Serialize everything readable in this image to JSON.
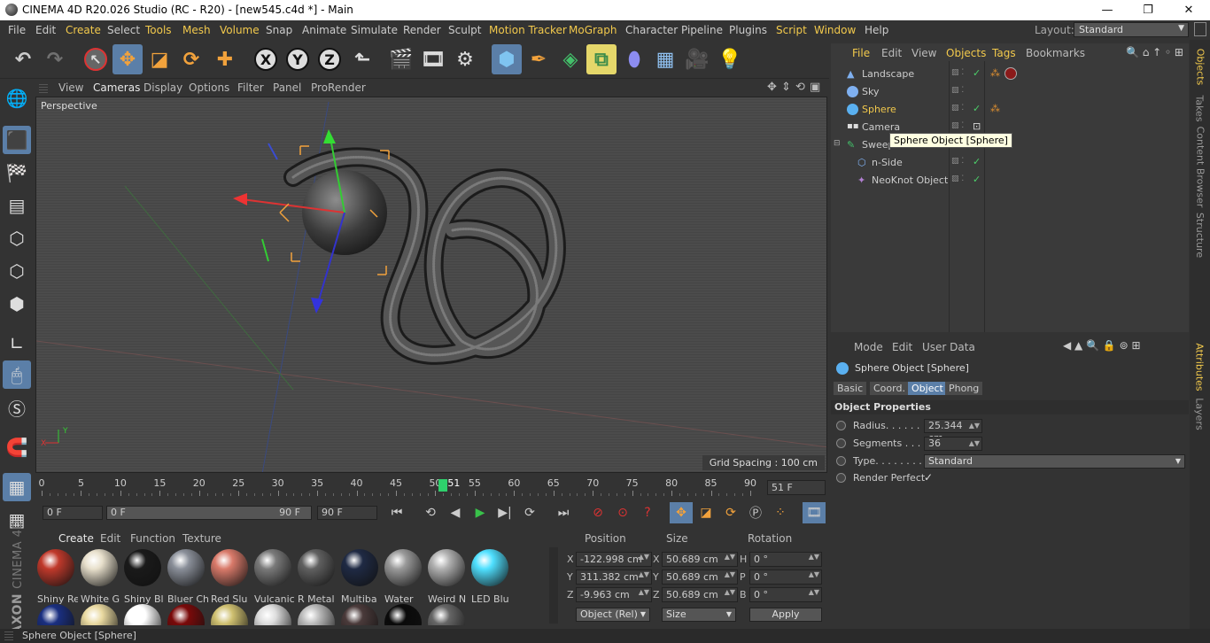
{
  "window": {
    "title": "CINEMA 4D R20.026 Studio (RC - R20) - [new545.c4d *] - Main",
    "controls": [
      "—",
      "❐",
      "✕"
    ]
  },
  "menu": [
    "File",
    "Edit",
    "Create",
    "Select",
    "Tools",
    "Mesh",
    "Volume",
    "Snap",
    "Animate",
    "Simulate",
    "Render",
    "Sculpt",
    "Motion Tracker",
    "MoGraph",
    "Character",
    "Pipeline",
    "Plugins",
    "Script",
    "Window",
    "Help"
  ],
  "highlighted_menus": [
    "Create",
    "Tools",
    "Mesh",
    "Volume",
    "Motion Tracker",
    "MoGraph",
    "Script",
    "Window"
  ],
  "layout": {
    "label": "Layout:",
    "value": "Standard"
  },
  "toolbar": {
    "icons": [
      "undo-icon",
      "redo-icon",
      "live-selection-icon",
      "move-icon",
      "scale-icon",
      "rotate-icon",
      "recent-tool-icon",
      "x-axis-lock-icon",
      "y-axis-lock-icon",
      "z-axis-lock-icon",
      "world-coordinates-icon",
      "render-view-icon",
      "render-picture-viewer-icon",
      "render-settings-icon",
      "cube-icon",
      "pen-spline-icon",
      "subdivision-surface-icon",
      "array-icon",
      "deformer-icon",
      "floor-icon",
      "camera-icon",
      "light-icon"
    ],
    "axis_letters": [
      "X",
      "Y",
      "Z"
    ]
  },
  "viewport": {
    "menu": [
      "View",
      "Cameras",
      "Display",
      "Options",
      "Filter",
      "Panel",
      "ProRender"
    ],
    "active_menu": "Cameras",
    "label": "Perspective",
    "grid_spacing": "Grid Spacing : 100 cm"
  },
  "timeline": {
    "ticks": [
      0,
      5,
      10,
      15,
      20,
      25,
      30,
      35,
      40,
      45,
      50,
      55,
      60,
      65,
      70,
      75,
      80,
      85,
      90
    ],
    "current_frame": 51,
    "current_frame_label": "51",
    "current_frame_field": "51 F"
  },
  "transport": {
    "start_field": "0 F",
    "range_start": "0 F",
    "range_end": "90 F",
    "end_field": "90 F"
  },
  "material_manager": {
    "menu": [
      "Create",
      "Edit",
      "Function",
      "Texture"
    ],
    "active_menu": "Create",
    "materials": [
      {
        "name": "Shiny Re",
        "color": "#c0392b"
      },
      {
        "name": "White G",
        "color": "#e8e0cc"
      },
      {
        "name": "Shiny Bl",
        "color": "#1a1a1a"
      },
      {
        "name": "Bluer Ch",
        "color": "#8a8f99"
      },
      {
        "name": "Red Slu",
        "color": "#d97a6a"
      },
      {
        "name": "Vulcanic",
        "color": "#7a7a7a"
      },
      {
        "name": "R Metal",
        "color": "#606060"
      },
      {
        "name": "Multiba",
        "color": "#1f2a44"
      },
      {
        "name": "Water",
        "color": "#9a9a9a"
      },
      {
        "name": "Weird N",
        "color": "#b0b0b0"
      },
      {
        "name": "LED Blu",
        "color": "#4fe0ff"
      }
    ],
    "second_row_colors": [
      "#1a2f80",
      "#e9d9a0",
      "#ffffff",
      "#7a0a0a",
      "#cfc070",
      "#dddddd",
      "#bbbbbb",
      "#4a3a3a",
      "#0a0a0a",
      "#666666"
    ]
  },
  "coordinates": {
    "headers": [
      "Position",
      "Size",
      "Rotation"
    ],
    "position": {
      "X": "-122.998 cm",
      "Y": "311.382 cm",
      "Z": "-9.963 cm"
    },
    "size": {
      "X": "50.689 cm",
      "Y": "50.689 cm",
      "Z": "50.689 cm"
    },
    "rotation": {
      "H": "0 °",
      "P": "0 °",
      "B": "0 °"
    },
    "mode": "Object (Rel)",
    "size_mode": "Size",
    "apply": "Apply"
  },
  "object_manager": {
    "menu": [
      "File",
      "Edit",
      "View",
      "Objects",
      "Tags",
      "Bookmarks"
    ],
    "active_menus": [
      "File",
      "Objects",
      "Tags"
    ],
    "objects": [
      {
        "name": "Landscape",
        "selected": false
      },
      {
        "name": "Sky",
        "selected": false
      },
      {
        "name": "Sphere",
        "selected": true
      },
      {
        "name": "Camera",
        "selected": false
      },
      {
        "name": "Sweep",
        "selected": false
      },
      {
        "name": "n-Side",
        "selected": false
      },
      {
        "name": "NeoKnot Object",
        "selected": false
      }
    ],
    "tooltip": "Sphere Object [Sphere]"
  },
  "attributes": {
    "menu": [
      "Mode",
      "Edit",
      "User Data"
    ],
    "object_title": "Sphere Object [Sphere]",
    "tabs": [
      "Basic",
      "Coord.",
      "Object",
      "Phong"
    ],
    "active_tab": "Object",
    "section": "Object Properties",
    "fields": {
      "radius_label": "Radius. . . . . .",
      "radius": "25.344 cm",
      "segments_label": "Segments . . . .",
      "segments": "36",
      "type_label": "Type. . . . . . . . .",
      "type": "Standard",
      "render_perfect_label": "Render Perfect",
      "render_perfect": "✓"
    }
  },
  "right_tabs": [
    "Objects",
    "Takes",
    "Content Browser",
    "Structure",
    "Attributes",
    "Layers"
  ],
  "active_right_tabs": [
    "Objects",
    "Attributes"
  ],
  "status": "Sphere Object [Sphere]"
}
